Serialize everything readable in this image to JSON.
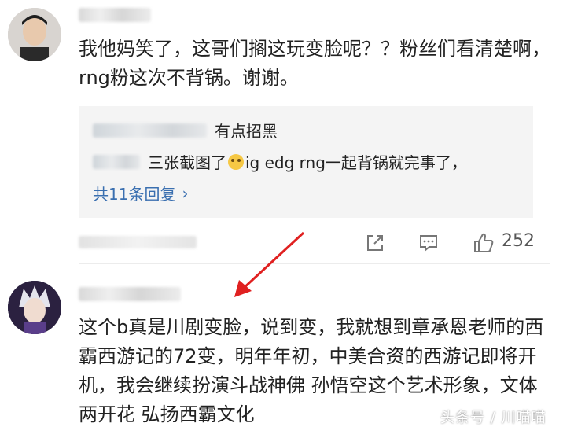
{
  "comment1": {
    "text": "我他妈笑了，这哥们搁这玩变脸呢？？粉丝们看清楚啊，rng粉这次不背锅。谢谢。"
  },
  "replies": [
    {
      "text": "有点招黑"
    },
    {
      "text_before": "三张截图了",
      "emoji": "cat-emoji",
      "text_after": "ig edg rng一起背锅就完事了，"
    }
  ],
  "more_replies_label": "共11条回复",
  "like_count": "252",
  "comment2": {
    "text": "这个b真是川剧变脸，说到变，我就想到章承恩老师的西霸西游记的72变，明年年初，中美合资的西游记即将开机，我会继续扮演斗战神佛 孙悟空这个艺术形象，文体两开花 弘扬西霸文化"
  },
  "watermark": "头条号 / 川喵喵",
  "colors": {
    "link": "#3a6fb0",
    "arrow": "#e02020",
    "reply_bg": "#f4f4f4"
  }
}
